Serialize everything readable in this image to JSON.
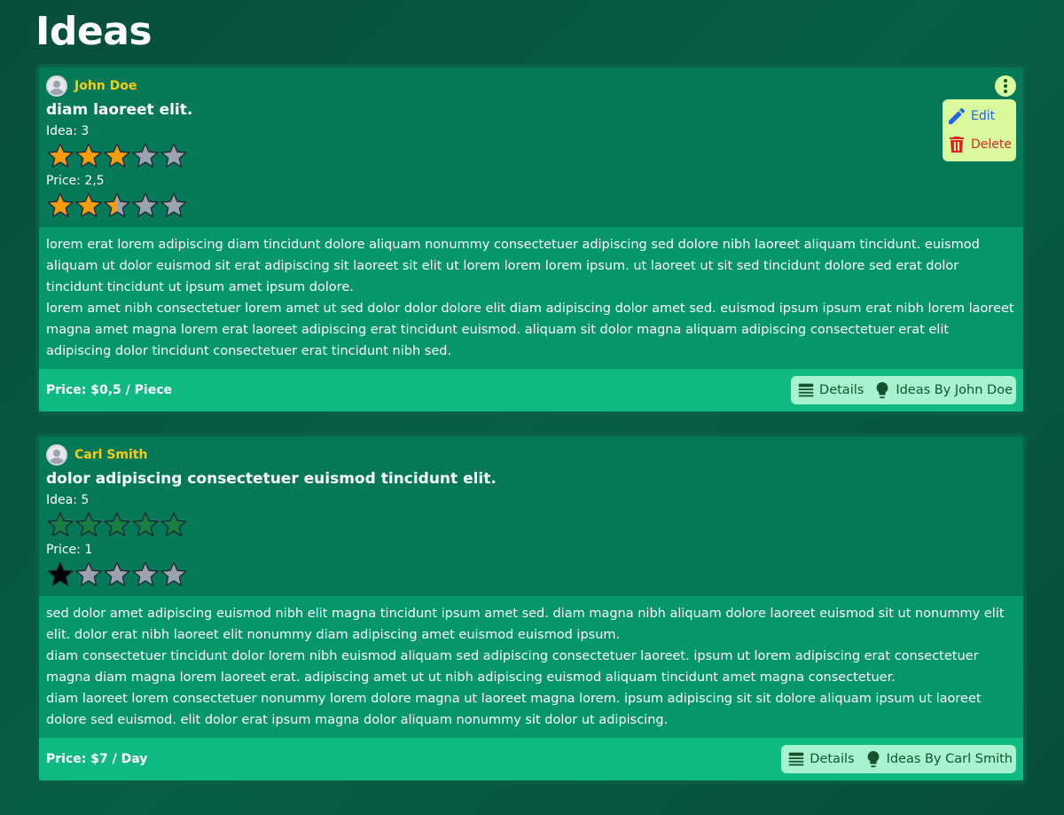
{
  "page": {
    "title": "Ideas"
  },
  "colors": {
    "star_orange": "#f59e0b",
    "star_gray": "#9ca3af",
    "star_green": "#15803d",
    "star_black": "#000000",
    "author": "#facc15"
  },
  "cards": [
    {
      "author": "John Doe",
      "title": "diam laoreet elit.",
      "idea_label": "Idea: 3",
      "idea_rating": 3,
      "idea_color": "orange",
      "price_label": "Price: 2,5",
      "price_rating": 2.5,
      "price_color": "orange",
      "menu": {
        "edit": "Edit",
        "delete": "Delete"
      },
      "body": [
        "lorem erat lorem adipiscing diam tincidunt dolore aliquam nonummy consectetuer adipiscing sed dolore nibh laoreet aliquam tincidunt. euismod aliquam ut dolor euismod sit erat adipiscing sit laoreet sit elit ut lorem lorem lorem ipsum. ut laoreet ut sit sed tincidunt dolore sed erat dolor tincidunt tincidunt ut ipsum amet ipsum dolore.",
        "lorem amet nibh consectetuer lorem amet ut sed dolor dolor dolore elit diam adipiscing dolor amet sed. euismod ipsum ipsum erat nibh lorem laoreet magna amet magna lorem erat laoreet adipiscing erat tincidunt euismod. aliquam sit dolor magna aliquam adipiscing consectetuer erat elit adipiscing dolor tincidunt consectetuer erat tincidunt nibh sed."
      ],
      "price": "Price: $0,5 / Piece",
      "details_label": "Details",
      "ideas_by_label": "Ideas By John Doe"
    },
    {
      "author": "Carl Smith",
      "title": "dolor adipiscing consectetuer euismod tincidunt elit.",
      "idea_label": "Idea: 5",
      "idea_rating": 5,
      "idea_color": "green",
      "price_label": "Price: 1",
      "price_rating": 1,
      "price_color": "black",
      "body": [
        "sed dolor amet adipiscing euismod nibh elit magna tincidunt ipsum amet sed. diam magna nibh aliquam dolore laoreet euismod sit ut nonummy elit elit. dolor erat nibh laoreet elit nonummy diam adipiscing amet euismod euismod ipsum.",
        "diam consectetuer tincidunt dolor lorem nibh euismod aliquam sed adipiscing consectetuer laoreet. ipsum ut lorem adipiscing erat consectetuer magna diam magna lorem laoreet erat. adipiscing amet ut ut nibh adipiscing euismod aliquam tincidunt amet magna consectetuer.",
        "diam laoreet lorem consectetuer nonummy lorem dolore magna ut laoreet magna lorem. ipsum adipiscing sit sit dolore aliquam ipsum ut laoreet dolore sed euismod. elit dolor erat ipsum magna dolor aliquam nonummy sit dolor ut adipiscing."
      ],
      "price": "Price: $7 / Day",
      "details_label": "Details",
      "ideas_by_label": "Ideas By Carl Smith"
    }
  ]
}
